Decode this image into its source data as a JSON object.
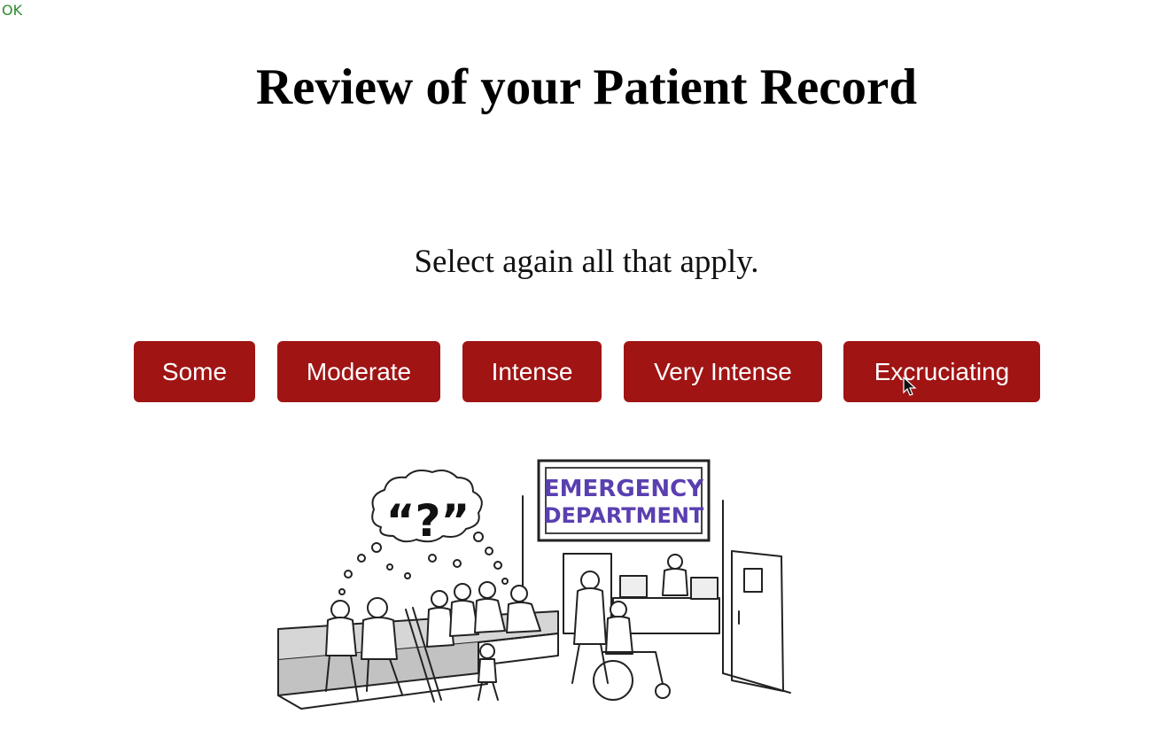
{
  "status": {
    "text": "OK",
    "color": "#2e8b2e"
  },
  "page": {
    "title": "Review of your Patient Record",
    "instruction": "Select again all that apply."
  },
  "options": [
    {
      "label": "Some"
    },
    {
      "label": "Moderate"
    },
    {
      "label": "Intense"
    },
    {
      "label": "Very Intense"
    },
    {
      "label": "Excruciating"
    }
  ],
  "illustration": {
    "sign_line1": "EMERGENCY",
    "sign_line2": "DEPARTMENT",
    "thought_text": "“?”",
    "sign_color": "#5a3fb0"
  },
  "colors": {
    "button_bg": "#a01414",
    "button_text": "#ffffff"
  }
}
